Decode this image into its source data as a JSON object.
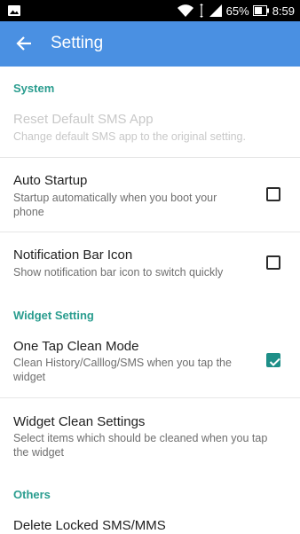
{
  "statusbar": {
    "battery": "65%",
    "time": "8:59"
  },
  "appbar": {
    "title": "Setting"
  },
  "sections": {
    "system": "System",
    "widget": "Widget Setting",
    "others": "Others"
  },
  "items": {
    "reset_sms": {
      "title": "Reset Default SMS App",
      "summary": "Change default SMS app to the original setting."
    },
    "auto_startup": {
      "title": "Auto Startup",
      "summary_line1": "Startup automatically when you boot your",
      "summary_line2": "phone",
      "checked": false
    },
    "notif_icon": {
      "title": "Notification Bar Icon",
      "summary": "Show notification bar icon to switch quickly",
      "checked": false
    },
    "one_tap": {
      "title": "One Tap Clean Mode",
      "summary_line1": "Clean History/Calllog/SMS when you tap the",
      "summary_line2": "widget",
      "checked": true
    },
    "widget_clean": {
      "title": "Widget Clean Settings",
      "summary_line1": "Select items which should be cleaned when you tap",
      "summary_line2": "the widget"
    },
    "delete_locked": {
      "title": "Delete Locked SMS/MMS"
    }
  },
  "colors": {
    "appbar": "#4a90e2",
    "accent": "#2a9d8f",
    "checkbox_checked": "#1e8f88"
  }
}
